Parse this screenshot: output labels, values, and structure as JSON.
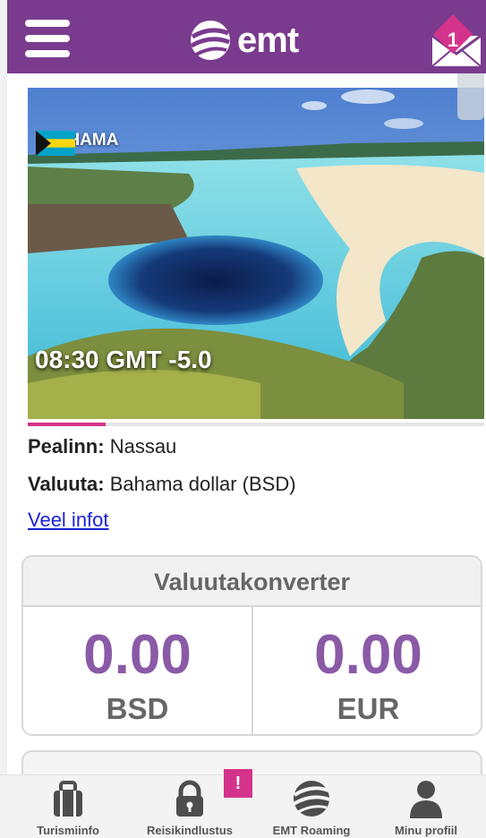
{
  "header": {
    "logo_text": "emt",
    "mail_badge": "1",
    "accent_color": "#7a3b8e"
  },
  "destination": {
    "country": "BAHAMA",
    "local_time": "08:30 GMT -5.0",
    "progress_fraction": 0.17
  },
  "info": {
    "capital_label": "Pealinn:",
    "capital_value": "Nassau",
    "currency_label": "Valuuta:",
    "currency_value": "Bahama dollar (BSD)",
    "more_link": "Veel infot"
  },
  "converter": {
    "title": "Valuutakonverter",
    "left_value": "0.00",
    "left_currency": "BSD",
    "right_value": "0.00",
    "right_currency": "EUR"
  },
  "bottom_nav": {
    "items": [
      {
        "label": "Turismiinfo",
        "icon": "suitcase-icon"
      },
      {
        "label": "Reisikindlustus",
        "icon": "lock-icon",
        "alert": "!"
      },
      {
        "label": "EMT Roaming",
        "icon": "globe-icon"
      },
      {
        "label": "Minu profiil",
        "icon": "person-icon"
      }
    ]
  }
}
